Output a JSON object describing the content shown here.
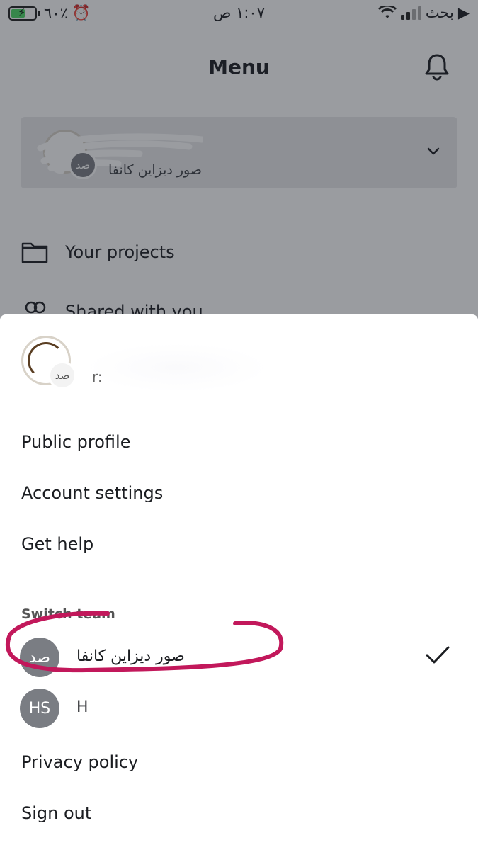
{
  "status_bar": {
    "battery_percent": "٦٠٪",
    "time": "١:٠٧ ص",
    "carrier": "بحث"
  },
  "header": {
    "title": "Menu",
    "notifications_icon": "bell-icon"
  },
  "team_switcher": {
    "team_name": "صور ديزاين كانفا",
    "team_initials": "صد",
    "expand_icon": "chevron-down-icon"
  },
  "nav": {
    "items": [
      {
        "label": "Your projects",
        "icon": "folder-icon"
      },
      {
        "label": "Shared with you",
        "icon": "people-icon"
      }
    ]
  },
  "sheet": {
    "user": {
      "handle": "r:",
      "team_initials": "صد"
    },
    "account_items": [
      {
        "label": "Public profile"
      },
      {
        "label": "Account settings"
      },
      {
        "label": "Get help"
      }
    ],
    "switch_team_label": "Switch team",
    "teams": [
      {
        "initials": "صد",
        "name": "صور ديزاين كانفا",
        "selected": true
      },
      {
        "initials": "HS",
        "name": "H",
        "selected": false
      }
    ],
    "footer_items": [
      {
        "label": "Privacy policy"
      },
      {
        "label": "Sign out"
      }
    ]
  },
  "colors": {
    "overlay": "#1e232d",
    "avatar_gray": "#7a7d83",
    "annotation": "#c2185b",
    "battery_green": "#4cd964"
  }
}
